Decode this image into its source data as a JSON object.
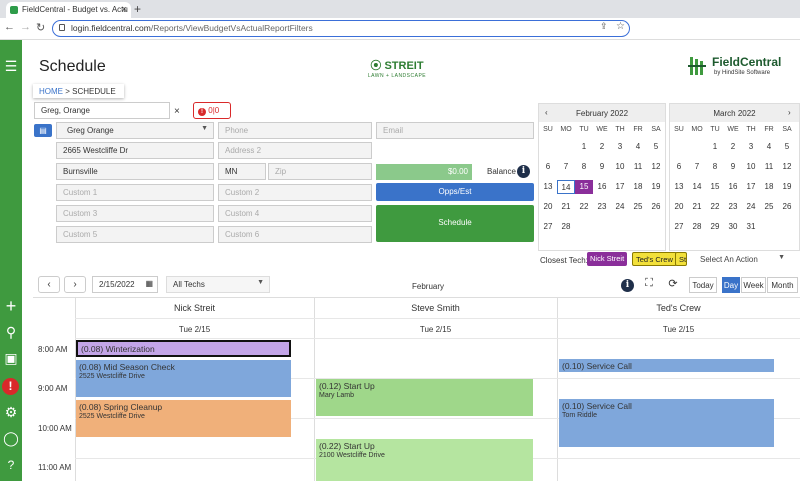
{
  "browser": {
    "tab_title": "FieldCentral - Budget vs. Actu",
    "url_host": "login.fieldcentral.com",
    "url_path": "/Reports/ViewBudgetVsActualReportFilters"
  },
  "page": {
    "title": "Schedule",
    "breadcrumb_home": "HOME",
    "breadcrumb_sep": " > ",
    "breadcrumb_current": "SCHEDULE"
  },
  "logos": {
    "streit_name": "STREIT",
    "streit_sub": "LAWN + LANDSCAPE",
    "fc_name": "FieldCentral",
    "fc_sub": "by HindSite Software"
  },
  "customer": {
    "search_value": "Greg, Orange",
    "alert_count": "0",
    "alert_total": "0",
    "contact_name": "Greg Orange",
    "phone_placeholder": "Phone",
    "email_placeholder": "Email",
    "address1": "2665 Westcliffe Dr",
    "address2_placeholder": "Address 2",
    "city": "Burnsville",
    "state": "MN",
    "zip_placeholder": "Zip",
    "custom1": "Custom 1",
    "custom2": "Custom 2",
    "custom3": "Custom 3",
    "custom4": "Custom 4",
    "custom5": "Custom 5",
    "custom6": "Custom 6",
    "balance_amount": "$0.00",
    "balance_label": "Balance",
    "opps_label": "Opps/Est",
    "schedule_label": "Schedule"
  },
  "calendars": {
    "dow": [
      "SU",
      "MO",
      "TU",
      "WE",
      "TH",
      "FR",
      "SA"
    ],
    "feb_title": "February 2022",
    "mar_title": "March 2022"
  },
  "closest_tech": {
    "label": "Closest Tech:",
    "tech1": "Nick Streit",
    "tech2": "Ted's Crew",
    "tech3": "St",
    "action_placeholder": "Select An Action"
  },
  "toolbar": {
    "date": "2/15/2022",
    "tech_filter": "All Techs",
    "month_label": "February",
    "today": "Today",
    "day": "Day",
    "week": "Week",
    "month": "Month"
  },
  "scheduler": {
    "columns": [
      {
        "name": "Nick Streit",
        "date": "Tue 2/15"
      },
      {
        "name": "Steve Smith",
        "date": "Tue 2/15"
      },
      {
        "name": "Ted's Crew",
        "date": "Tue 2/15"
      }
    ],
    "times": [
      "8:00 AM",
      "9:00 AM",
      "10:00 AM",
      "11:00 AM"
    ],
    "appointments": [
      {
        "title": "(0.08) Winterization",
        "sub": "",
        "color": "#c3a5e8"
      },
      {
        "title": "(0.08) Mid Season Check",
        "sub": "2525 Westcliffe Drive",
        "color": "#7fa7db"
      },
      {
        "title": "(0.08) Spring Cleanup",
        "sub": "2525 Westcliffe Drive",
        "color": "#f0b07a"
      },
      {
        "title": "(0.12) Start Up",
        "sub": "Mary Lamb",
        "color": "#9fd78a"
      },
      {
        "title": "(0.22) Start Up",
        "sub": "2100 Westcliffe Drive",
        "color": "#b5e5a0"
      },
      {
        "title": "(0.10) Service Call",
        "sub": "",
        "color": "#7fa7db"
      },
      {
        "title": "(0.10) Service Call",
        "sub": "Tom Riddle",
        "color": "#7fa7db"
      }
    ]
  },
  "colors": {
    "brand_green": "#3f9a3f",
    "accent_blue": "#3a73c9",
    "selected_day": "#8a2e9a",
    "alert_red": "#d9292a"
  }
}
